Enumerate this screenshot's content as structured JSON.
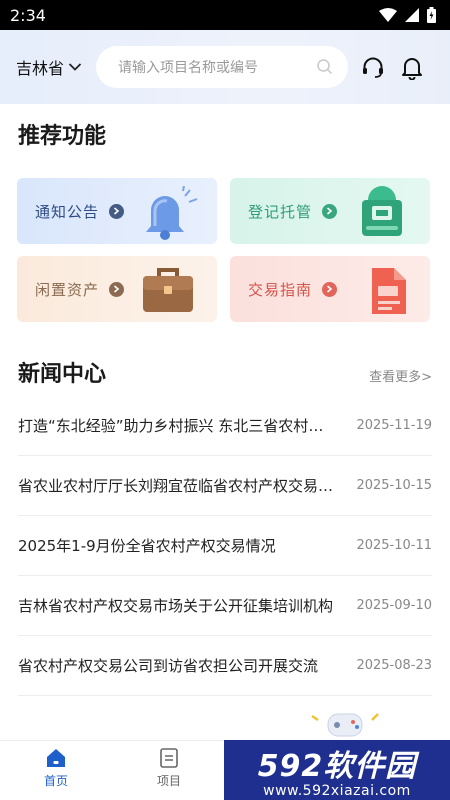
{
  "status_bar": {
    "time": "2:34"
  },
  "header": {
    "province": "吉林省",
    "search_placeholder": "请输入项目名称或编号"
  },
  "recommend": {
    "title": "推荐功能",
    "cards": [
      {
        "label": "通知公告"
      },
      {
        "label": "登记托管"
      },
      {
        "label": "闲置资产"
      },
      {
        "label": "交易指南"
      }
    ]
  },
  "news": {
    "title": "新闻中心",
    "more": "查看更多>",
    "items": [
      {
        "title": "打造“东北经验”助力乡村振兴 东北三省农村产权",
        "date": "2025-11-19"
      },
      {
        "title": "省农业农村厅厅长刘翔宜莅临省农村产权交易公司",
        "date": "2025-10-15"
      },
      {
        "title": "2025年1-9月份全省农村产权交易情况",
        "date": "2025-10-11"
      },
      {
        "title": "吉林省农村产权交易市场关于公开征集培训机构",
        "date": "2025-09-10"
      },
      {
        "title": "省农村产权交易公司到访省农担公司开展交流",
        "date": "2025-08-23"
      }
    ]
  },
  "tab_bar": {
    "items": [
      {
        "label": "首页",
        "active": true
      },
      {
        "label": "项目",
        "active": false
      }
    ]
  },
  "watermark": {
    "brand": "592软件园",
    "url": "www.592xiazai.com"
  },
  "colors": {
    "accent": "#1f5fc9",
    "tab_active": "#1f5fc9"
  }
}
